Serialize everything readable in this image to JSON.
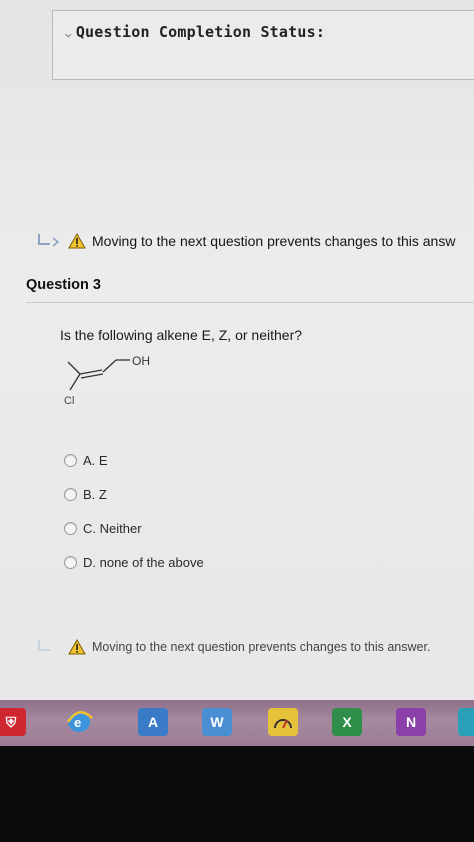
{
  "status": {
    "title": "Question Completion Status:"
  },
  "warning": {
    "text_top": "Moving to the next question prevents changes to this answ",
    "text_bottom": "Moving to the next question prevents changes to this answer."
  },
  "question": {
    "title": "Question 3",
    "prompt": "Is the following alkene E, Z, or neither?",
    "molecule": {
      "labels": {
        "oh": "OH",
        "cl": "Cl"
      }
    },
    "options": [
      {
        "label": "A. E"
      },
      {
        "label": "B. Z"
      },
      {
        "label": "C. Neither"
      },
      {
        "label": "D. none of the above"
      }
    ]
  },
  "taskbar": {
    "items": [
      {
        "name": "security-app",
        "icon": "shield-icon",
        "color": "#d0262f"
      },
      {
        "name": "internet-explorer",
        "icon": "ie-icon",
        "color": "#2e8ad8"
      },
      {
        "name": "access",
        "icon": "access-icon",
        "color": "#3a7bc8",
        "glyph": "A"
      },
      {
        "name": "word",
        "icon": "word-icon",
        "color": "#4a8fd4",
        "glyph": "W"
      },
      {
        "name": "speedometer",
        "icon": "gauge-icon",
        "color": "#e5c23a"
      },
      {
        "name": "excel",
        "icon": "excel-icon",
        "color": "#2f8f4a",
        "glyph": "X"
      },
      {
        "name": "onenote",
        "icon": "onenote-icon",
        "color": "#8b3fa8",
        "glyph": "N"
      },
      {
        "name": "partial",
        "icon": "app-icon",
        "color": "#2aa0b8"
      }
    ]
  }
}
